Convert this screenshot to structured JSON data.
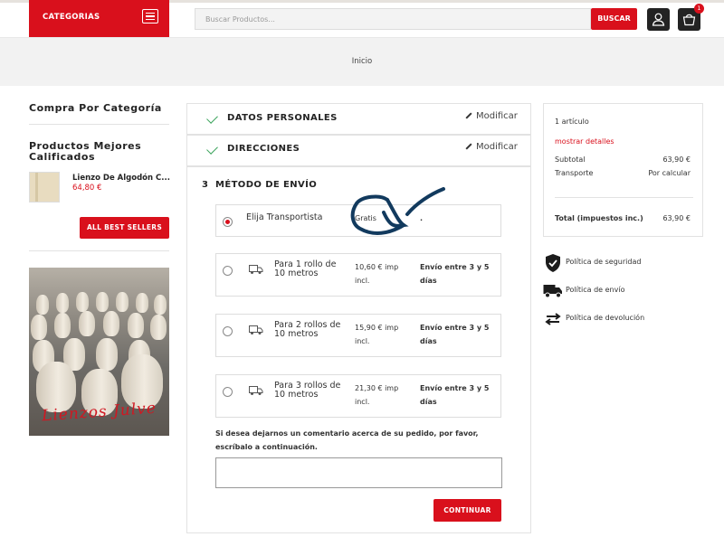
{
  "header": {
    "categories_label": "CATEGORIAS",
    "search_placeholder": "Buscar Productos...",
    "search_button": "BUSCAR",
    "cart_count": "1",
    "colors": {
      "brand": "#d9101c",
      "dark": "#232323"
    }
  },
  "breadcrumb": {
    "home": "Inicio"
  },
  "sidebar": {
    "categories_title": "Compra Por Categoría",
    "best_title_line1": "Productos Mejores",
    "best_title_line2": "Calificados",
    "product": {
      "name": "Lienzo De Algodón C...",
      "price": "64,80 €"
    },
    "best_sellers_button": "ALL BEST SELLERS",
    "promo_caption": "Lienzos Julve"
  },
  "checkout": {
    "step1": {
      "title": "DATOS PERSONALES",
      "modify": "Modificar"
    },
    "step2": {
      "title": "DIRECCIONES",
      "modify": "Modificar"
    },
    "step3": {
      "number": "3",
      "title": "MÉTODO DE ENVÍO"
    },
    "shipping_options": [
      {
        "name": "Elija Transportista",
        "price": "Gratis",
        "delay": ".",
        "selected": true
      },
      {
        "name_line1": "Para 1 rollo de",
        "name_line2": "10 metros",
        "price_line1": "10,60 € imp",
        "price_line2": "incl.",
        "delay_line1": "Envío entre 3 y 5",
        "delay_line2": "días",
        "selected": false
      },
      {
        "name_line1": "Para 2 rollos de",
        "name_line2": "10 metros",
        "price_line1": "15,90 € imp",
        "price_line2": "incl.",
        "delay_line1": "Envío entre 3 y 5",
        "delay_line2": "días",
        "selected": false
      },
      {
        "name_line1": "Para 3 rollos de",
        "name_line2": "10 metros",
        "price_line1": "21,30 € imp",
        "price_line2": "incl.",
        "delay_line1": "Envío entre 3 y 5",
        "delay_line2": "días",
        "selected": false
      }
    ],
    "comment_label_line1": "Si desea dejarnos un comentario acerca de su pedido, por favor,",
    "comment_label_line2": "escríbalo a continuación.",
    "comment_value": "",
    "continue_button": "CONTINUAR"
  },
  "summary": {
    "items": "1 artículo",
    "show_details": "mostrar detalles",
    "subtotal_label": "Subtotal",
    "subtotal_value": "63,90 €",
    "shipping_label": "Transporte",
    "shipping_value": "Por calcular",
    "total_label": "Total (impuestos inc.)",
    "total_value": "63,90 €"
  },
  "policies": [
    {
      "label": "Política de seguridad",
      "icon": "shield-check-icon"
    },
    {
      "label": "Política de envío",
      "icon": "truck-icon"
    },
    {
      "label": "Política de devolución",
      "icon": "exchange-arrows-icon"
    }
  ]
}
